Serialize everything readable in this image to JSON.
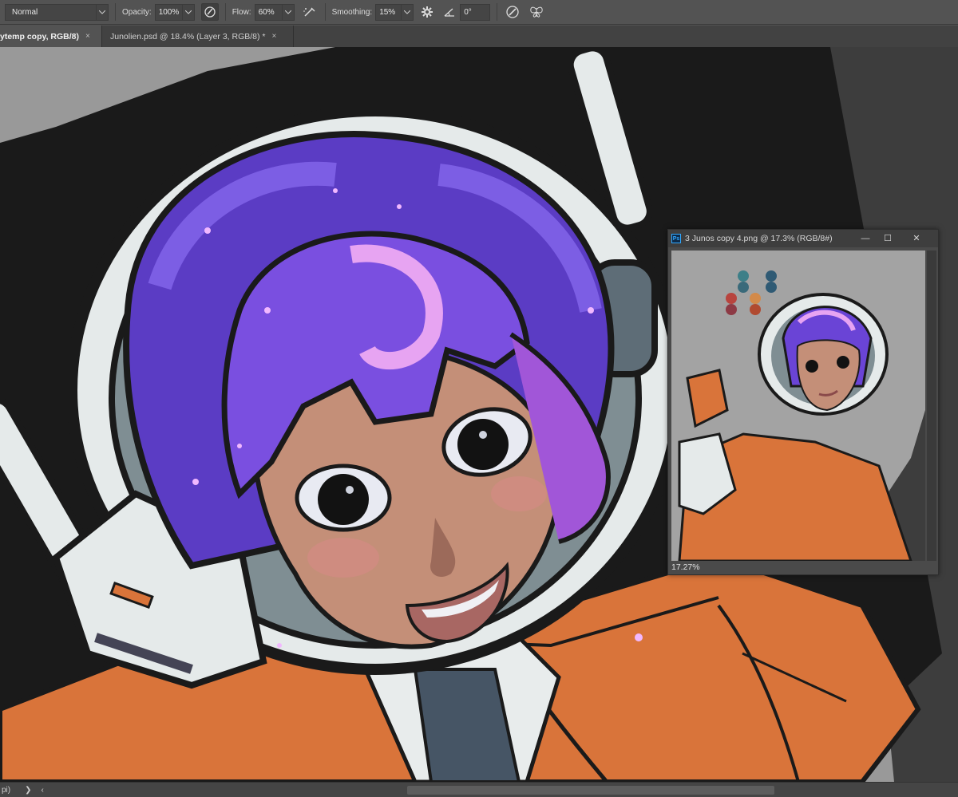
{
  "options_bar": {
    "mode": "Normal",
    "opacity_label": "Opacity:",
    "opacity_value": "100%",
    "flow_label": "Flow:",
    "flow_value": "60%",
    "smoothing_label": "Smoothing:",
    "smoothing_value": "15%",
    "angle_value": "0°"
  },
  "tabs": [
    {
      "label": "ytemp copy, RGB/8)",
      "close": "×",
      "active": true
    },
    {
      "label": "Junolien.psd @ 18.4% (Layer 3, RGB/8) *",
      "close": "×",
      "active": false
    }
  ],
  "doc_window": {
    "ps_badge": "Ps",
    "title": "3 Junos copy 4.png @ 17.3% (RGB/8#)",
    "minimize": "—",
    "maximize": "☐",
    "close": "✕",
    "zoom": "17.27%"
  },
  "status_bar": {
    "left_text": "pi)",
    "arrow": "❯",
    "scroll_left": "‹"
  },
  "colors": {
    "hair": "#7a4fe0",
    "suit": "#d9743a",
    "helmet": "#e5eaea",
    "skin": "#c48f78",
    "canvas_bg": "#999999"
  }
}
